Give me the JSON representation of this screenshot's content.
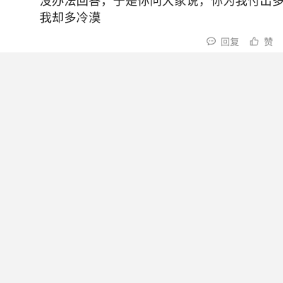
{
  "comment": {
    "lines": [
      "没办法回答，于是你问大家说，你为我付出多少",
      "我却多冷漠"
    ]
  },
  "actions": {
    "reply_label": "回复",
    "like_label": "赞",
    "reply_icon": "comment-bubble-icon",
    "like_icon": "thumbs-up-icon"
  }
}
